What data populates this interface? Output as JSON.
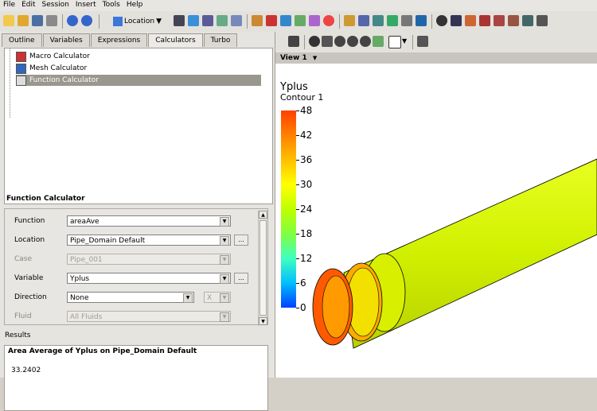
{
  "menu": [
    "File",
    "Edit",
    "Session",
    "Insert",
    "Tools",
    "Help"
  ],
  "toolbar": {
    "location_label": "Location"
  },
  "tabs": [
    "Outline",
    "Variables",
    "Expressions",
    "Calculators",
    "Turbo"
  ],
  "active_tab": 3,
  "tree": {
    "items": [
      {
        "label": "Macro Calculator",
        "icon": "macro-calculator-icon"
      },
      {
        "label": "Mesh Calculator",
        "icon": "mesh-calculator-icon"
      },
      {
        "label": "Function Calculator",
        "icon": "function-calculator-icon"
      }
    ],
    "selected": 2
  },
  "function_calculator": {
    "title": "Function Calculator",
    "fields": [
      {
        "label": "Function",
        "value": "areaAve",
        "enabled": true,
        "has_dots": false
      },
      {
        "label": "Location",
        "value": "Pipe_Domain Default",
        "enabled": true,
        "has_dots": true
      },
      {
        "label": "Case",
        "value": "Pipe_001",
        "enabled": false,
        "has_dots": false
      },
      {
        "label": "Variable",
        "value": "Yplus",
        "enabled": true,
        "has_dots": true
      },
      {
        "label": "Direction",
        "value": "None",
        "enabled": true,
        "has_dots": false,
        "secondary": "X"
      },
      {
        "label": "Fluid",
        "value": "All Fluids",
        "enabled": false,
        "has_dots": false
      }
    ],
    "dots_label": "..."
  },
  "results": {
    "label": "Results",
    "title": "Area Average of Yplus on Pipe_Domain Default",
    "value": "33.2402"
  },
  "viewer": {
    "view_label": "View 1",
    "legend": {
      "title": "Yplus",
      "subtitle": "Contour 1",
      "ticks": [
        "48",
        "42",
        "36",
        "30",
        "24",
        "18",
        "12",
        "6",
        "0"
      ],
      "colors": [
        "#ff4000",
        "#ff8000",
        "#ffbf00",
        "#ffff00",
        "#bfff00",
        "#80ff40",
        "#40ffbf",
        "#00bfff",
        "#0040ff"
      ]
    }
  }
}
